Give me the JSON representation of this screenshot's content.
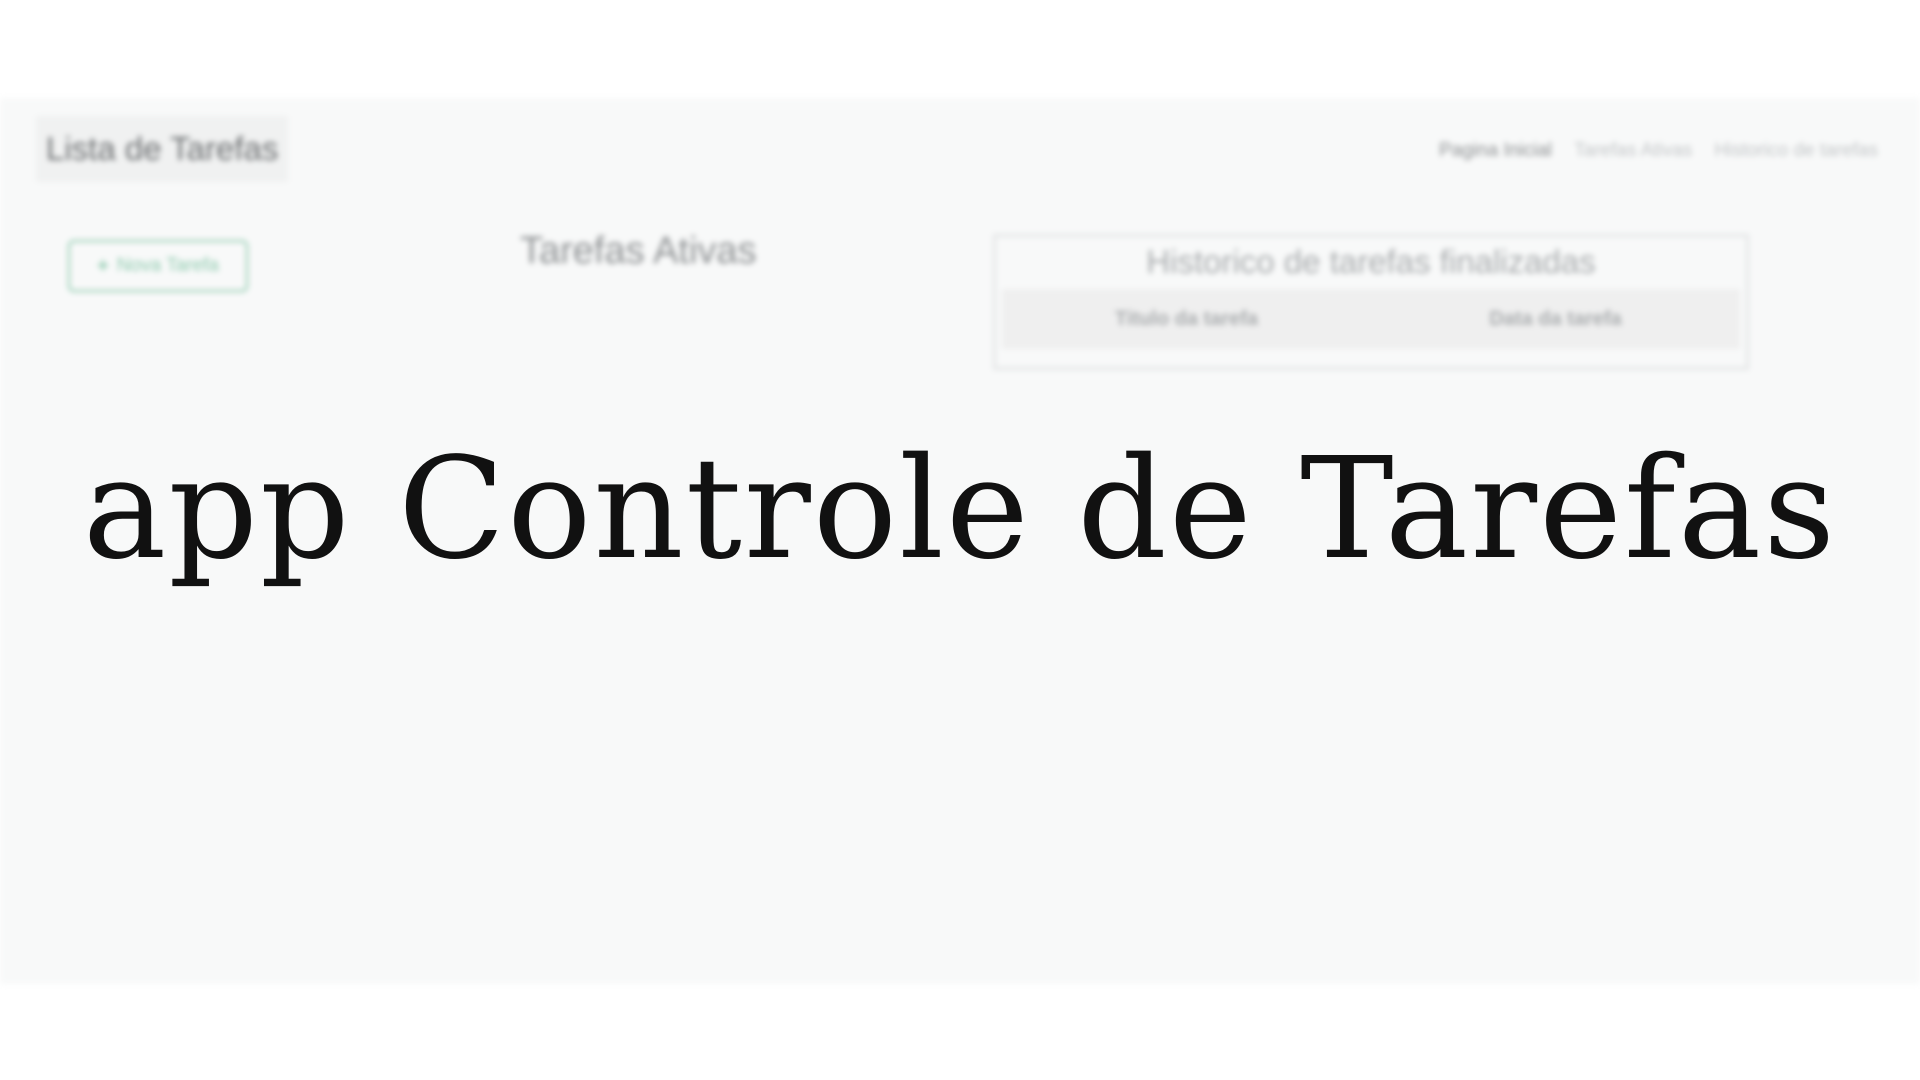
{
  "app": {
    "brand": "Lista de Tarefas",
    "nav": [
      {
        "label": "Pagina Inicial",
        "active": true
      },
      {
        "label": "Tarefas Ativas",
        "active": false
      },
      {
        "label": "Historico de tarefas",
        "active": false
      }
    ],
    "new_task": {
      "icon": "plus-icon",
      "label": "Nova Tarefa"
    },
    "active_section_title": "Tarefas Ativas",
    "history": {
      "title": "Historico de tarefas finalizadas",
      "columns": [
        "Titulo da tarefa",
        "Data da tarefa"
      ]
    }
  },
  "overlay": {
    "title": "app Controle de Tarefas"
  },
  "colors": {
    "accent_green": "#8dc9ad",
    "page_bg": "#f8f9f9",
    "title_text": "#111111"
  }
}
